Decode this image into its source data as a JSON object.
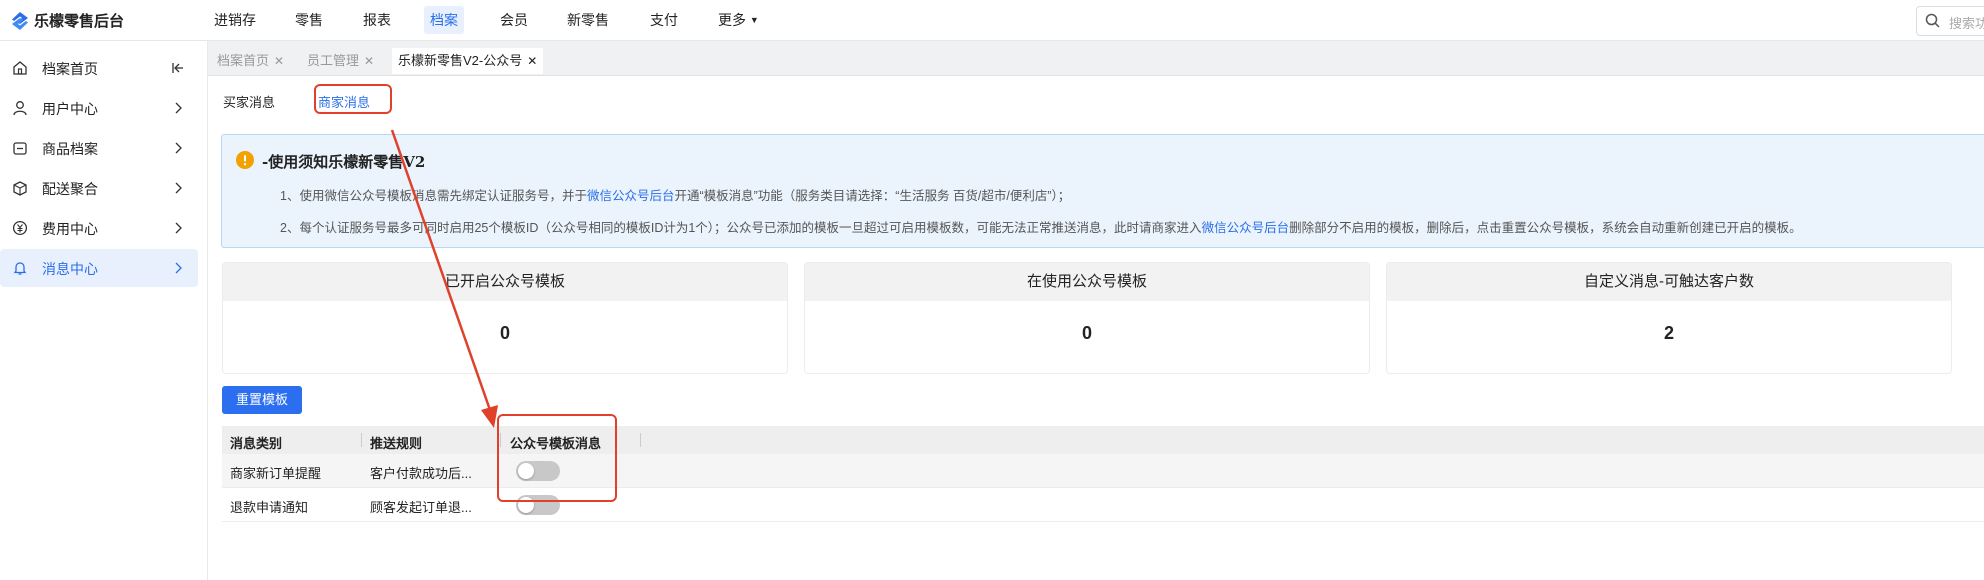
{
  "app": {
    "title": "乐檬零售后台"
  },
  "nav": {
    "items": [
      {
        "label": "进销存"
      },
      {
        "label": "零售"
      },
      {
        "label": "报表"
      },
      {
        "label": "档案",
        "active": true
      },
      {
        "label": "会员"
      },
      {
        "label": "新零售"
      },
      {
        "label": "支付"
      },
      {
        "label": "更多"
      }
    ],
    "search_placeholder": "搜索功"
  },
  "sidebar": {
    "items": [
      {
        "label": "档案首页",
        "icon": "home-icon"
      },
      {
        "label": "用户中心",
        "icon": "user-icon"
      },
      {
        "label": "商品档案",
        "icon": "product-icon"
      },
      {
        "label": "配送聚合",
        "icon": "delivery-icon"
      },
      {
        "label": "费用中心",
        "icon": "fee-icon"
      },
      {
        "label": "消息中心",
        "icon": "bell-icon",
        "active": true
      }
    ]
  },
  "tabs": [
    {
      "label": "档案首页"
    },
    {
      "label": "员工管理"
    },
    {
      "label": "乐檬新零售V2-公众号",
      "active": true
    }
  ],
  "subtabs": [
    {
      "label": "买家消息"
    },
    {
      "label": "商家消息",
      "active": true
    }
  ],
  "notice": {
    "title": "-使用须知乐檬新零售V2",
    "line1": {
      "before": "1、使用微信公众号模板消息需先绑定认证服务号，并于",
      "link": "微信公众号后台",
      "after": "开通“模板消息”功能（服务类目请选择：“生活服务 百货/超市/便利店”）；"
    },
    "line2": {
      "before": "2、每个认证服务号最多可同时启用25个模板ID（公众号相同的模板ID计为1个）；公众号已添加的模板一旦超过可启用模板数，可能无法正常推送消息，此时请商家进入",
      "link": "微信公众号后台",
      "after": "删除部分不启用的模板，删除后，点击重置公众号模板，系统会自动重新创建已开启的模板。"
    }
  },
  "stats": [
    {
      "label": "已开启公众号模板",
      "value": "0"
    },
    {
      "label": "在使用公众号模板",
      "value": "0"
    },
    {
      "label": "自定义消息-可触达客户数",
      "value": "2"
    }
  ],
  "reset_button": "重置模板",
  "table": {
    "headers": [
      "消息类别",
      "推送规则",
      "公众号模板消息"
    ],
    "rows": [
      {
        "category": "商家新订单提醒",
        "rule": "客户付款成功后...",
        "enabled": false
      },
      {
        "category": "退款申请通知",
        "rule": "顾客发起订单退...",
        "enabled": false
      }
    ]
  },
  "colors": {
    "accent": "#2a6fe8",
    "highlight": "#e0412a",
    "notice_bg": "#ebf4fd",
    "warning": "#f2a200"
  }
}
